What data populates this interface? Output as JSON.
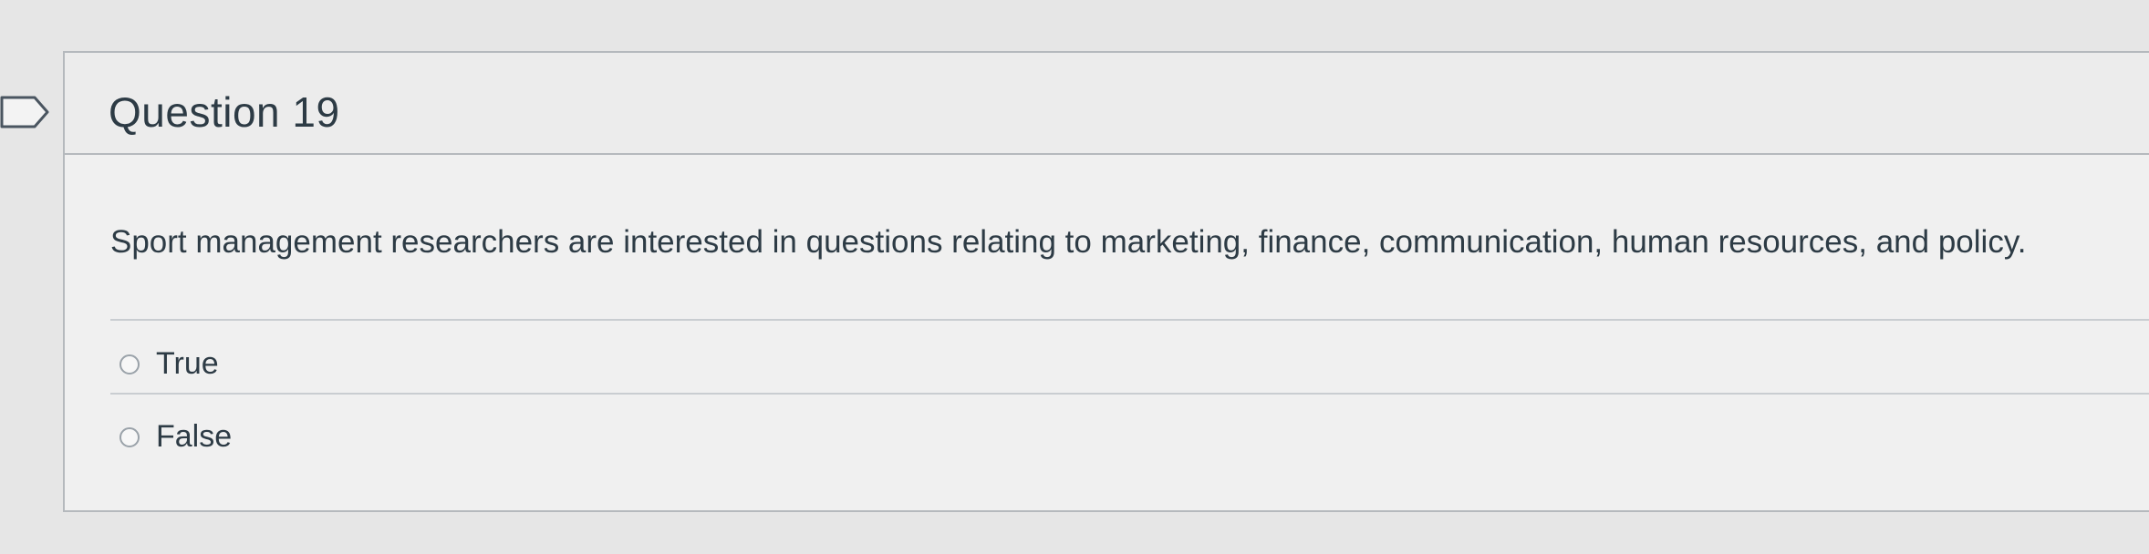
{
  "question": {
    "title": "Question 19",
    "text": "Sport management researchers are interested in questions relating to marketing, finance, communication, human resources, and policy.",
    "answers": [
      {
        "label": "True",
        "selected": false
      },
      {
        "label": "False",
        "selected": false
      }
    ]
  },
  "colors": {
    "background": "#e6e6e6",
    "card": "#f0f0f0",
    "border": "#b5b9bd",
    "text": "#2d3b45"
  },
  "icons": {
    "bookmark": "bookmark-flag-icon"
  }
}
